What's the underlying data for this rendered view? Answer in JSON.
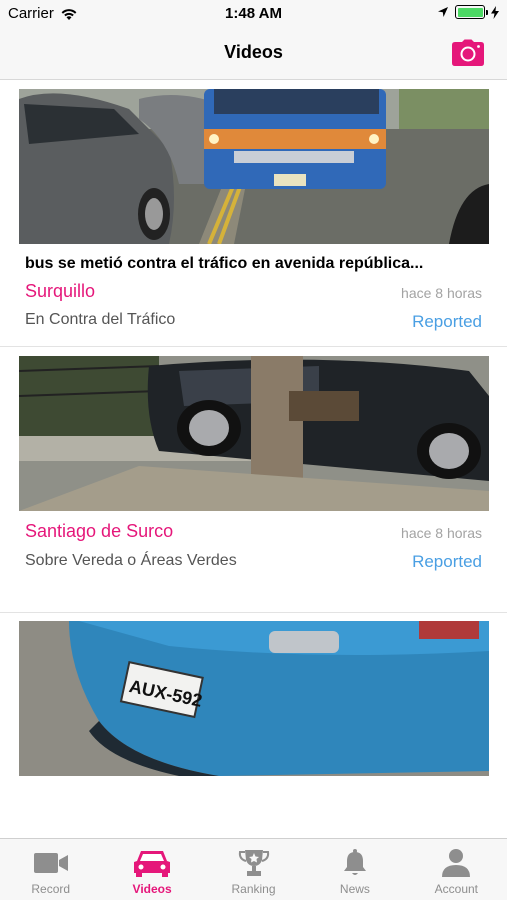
{
  "status_bar": {
    "carrier": "Carrier",
    "time": "1:48 AM"
  },
  "nav": {
    "title": "Videos",
    "action_icon": "camera-icon"
  },
  "videos": [
    {
      "title": "bus se metió contra el tráfico en avenida república...",
      "place": "Surquillo",
      "time_ago": "hace 8 horas",
      "category": "En Contra del Tráfico",
      "status": "Reported"
    },
    {
      "title": "",
      "place": "Santiago de Surco",
      "time_ago": "hace 8 horas",
      "category": "Sobre Vereda o Áreas Verdes",
      "status": "Reported"
    },
    {
      "title": "",
      "place": "",
      "time_ago": "",
      "category": "",
      "status": "",
      "plate_text": "AUX-592"
    }
  ],
  "tabs": [
    {
      "label": "Record",
      "icon": "video-camera-icon",
      "active": false
    },
    {
      "label": "Videos",
      "icon": "car-icon",
      "active": true
    },
    {
      "label": "Ranking",
      "icon": "trophy-icon",
      "active": false
    },
    {
      "label": "News",
      "icon": "bell-icon",
      "active": false
    },
    {
      "label": "Account",
      "icon": "person-icon",
      "active": false
    }
  ],
  "colors": {
    "accent": "#e5177a",
    "link": "#4a9fe3",
    "battery": "#4cd964"
  }
}
